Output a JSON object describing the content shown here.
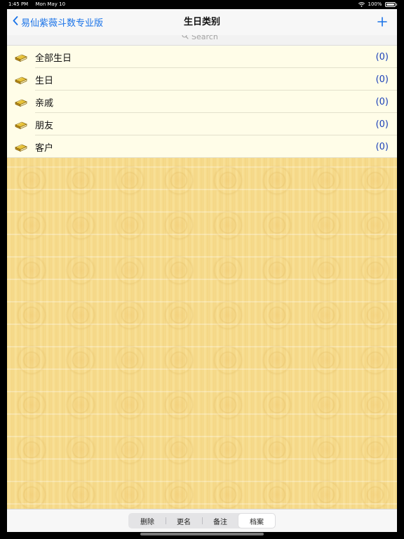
{
  "status_bar": {
    "time": "1:45 PM",
    "date": "Mon May 10",
    "battery": "100%"
  },
  "nav": {
    "back_label": "易仙紫薇斗数专业版",
    "title": "生日类别",
    "add_icon": "plus-icon"
  },
  "search": {
    "placeholder": "Search"
  },
  "categories": [
    {
      "label": "全部生日",
      "count": "(0)"
    },
    {
      "label": "生日",
      "count": "(0)"
    },
    {
      "label": "亲戚",
      "count": "(0)"
    },
    {
      "label": "朋友",
      "count": "(0)"
    },
    {
      "label": "客户",
      "count": "(0)"
    }
  ],
  "toolbar": {
    "segments": [
      {
        "label": "删除"
      },
      {
        "label": "更名"
      },
      {
        "label": "备注"
      },
      {
        "label": "档案"
      }
    ],
    "selected_index": 3
  },
  "colors": {
    "accent": "#1a73e8",
    "count_text": "#1a3fb8",
    "list_background": "#fffde8",
    "parchment": "#f7dc8c"
  }
}
